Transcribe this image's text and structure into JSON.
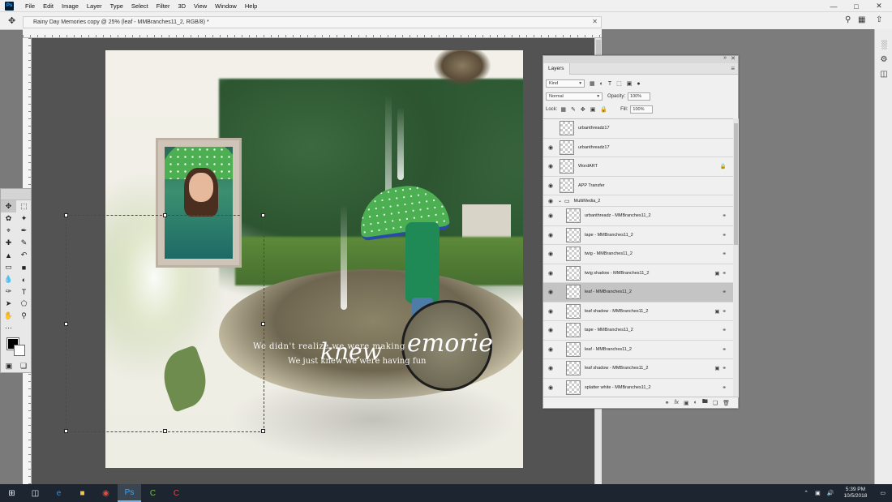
{
  "app": {
    "logo_text": "Ps",
    "menu": [
      "File",
      "Edit",
      "Image",
      "Layer",
      "Type",
      "Select",
      "Filter",
      "3D",
      "View",
      "Window",
      "Help"
    ]
  },
  "document": {
    "tab_title": "Rainy Day Memories copy @ 25% (leaf - MMBranches11_2, RGB/8) *"
  },
  "artwork": {
    "journal_line1": "We didn't realize we were making",
    "journal_line2": "We just knew we were having fun",
    "script_word": "knew",
    "circle_word": "emorie"
  },
  "layers_panel": {
    "tab_label": "Layers",
    "filter_kind": "Kind",
    "blend_mode": "Normal",
    "opacity_label": "Opacity:",
    "opacity_value": "100%",
    "lock_label": "Lock:",
    "fill_label": "Fill:",
    "fill_value": "100%",
    "layers": [
      {
        "name": "urbanthreadz17",
        "visible": false,
        "selected": false,
        "locked": false,
        "linked": false,
        "fx": false,
        "group": false
      },
      {
        "name": "urbanthreadz17",
        "visible": true,
        "selected": false,
        "locked": false,
        "linked": false,
        "fx": false,
        "group": false
      },
      {
        "name": "WordART",
        "visible": true,
        "selected": false,
        "locked": true,
        "linked": false,
        "fx": false,
        "group": false
      },
      {
        "name": "APP Transfer",
        "visible": true,
        "selected": false,
        "locked": false,
        "linked": false,
        "fx": false,
        "group": false
      },
      {
        "name": "MultiMedia_2",
        "visible": true,
        "selected": false,
        "locked": false,
        "linked": false,
        "fx": false,
        "group": true
      },
      {
        "name": "urbanthreadz - MMBranches11_2",
        "visible": true,
        "selected": false,
        "locked": false,
        "linked": true,
        "fx": false,
        "group": false
      },
      {
        "name": "tape - MMBranches11_2",
        "visible": true,
        "selected": false,
        "locked": false,
        "linked": true,
        "fx": false,
        "group": false
      },
      {
        "name": "twig - MMBranches11_2",
        "visible": true,
        "selected": false,
        "locked": false,
        "linked": true,
        "fx": false,
        "group": false
      },
      {
        "name": "twig shadow - MMBranches11_2",
        "visible": true,
        "selected": false,
        "locked": false,
        "linked": true,
        "fx": true,
        "group": false
      },
      {
        "name": "leaf - MMBranches11_2",
        "visible": true,
        "selected": true,
        "locked": false,
        "linked": true,
        "fx": false,
        "group": false
      },
      {
        "name": "leaf shadow - MMBranches11_2",
        "visible": true,
        "selected": false,
        "locked": false,
        "linked": true,
        "fx": true,
        "group": false
      },
      {
        "name": "tape - MMBranches11_2",
        "visible": true,
        "selected": false,
        "locked": false,
        "linked": true,
        "fx": false,
        "group": false
      },
      {
        "name": "leaf - MMBranches11_2",
        "visible": true,
        "selected": false,
        "locked": false,
        "linked": true,
        "fx": false,
        "group": false
      },
      {
        "name": "leaf shadow - MMBranches11_2",
        "visible": true,
        "selected": false,
        "locked": false,
        "linked": true,
        "fx": true,
        "group": false
      },
      {
        "name": "splatter white - MMBranches11_2",
        "visible": true,
        "selected": false,
        "locked": false,
        "linked": true,
        "fx": false,
        "group": false
      }
    ]
  },
  "taskbar": {
    "time": "5:39 PM",
    "date": "10/5/2018"
  }
}
